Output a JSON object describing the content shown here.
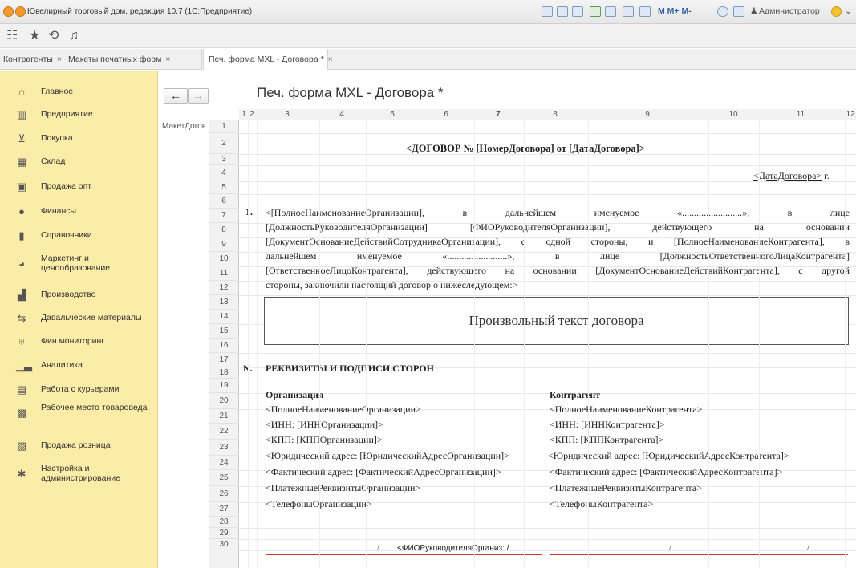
{
  "window": {
    "title": "Ювелирный торговый дом, редакция 10.7 (1С:Предприятие)",
    "toolbar_text": "M  M+  M-",
    "user": "Администратор"
  },
  "tabs": [
    {
      "label": "Контрагенты"
    },
    {
      "label": "Макеты печатных форм"
    },
    {
      "label": "Печ. форма MXL - Договора *"
    }
  ],
  "sidebar": {
    "items": [
      {
        "label": "Главное",
        "icon": "home-icon"
      },
      {
        "label": "Предприятие",
        "icon": "building-icon"
      },
      {
        "label": "Покупка",
        "icon": "cart-icon"
      },
      {
        "label": "Склад",
        "icon": "warehouse-icon"
      },
      {
        "label": "Продажа опт",
        "icon": "bag-icon"
      },
      {
        "label": "Финансы",
        "icon": "coin-icon"
      },
      {
        "label": "Справочники",
        "icon": "book-icon"
      },
      {
        "label": "Маркетинг и ценообразование",
        "icon": "pie-icon"
      },
      {
        "label": "Производство",
        "icon": "factory-icon"
      },
      {
        "label": "Давальческие материалы",
        "icon": "exchange-icon"
      },
      {
        "label": "Фин мониторинг",
        "icon": "eagle-icon"
      },
      {
        "label": "Аналитика",
        "icon": "chart-icon"
      },
      {
        "label": "Работа с курьерами",
        "icon": "courier-icon"
      },
      {
        "label": "Рабочее место товароведа",
        "icon": "workplace-icon"
      },
      {
        "label": "Продажа розница",
        "icon": "register-icon"
      },
      {
        "label": "Настройка и администрирование",
        "icon": "gear-icon"
      }
    ]
  },
  "doc": {
    "title": "Печ. форма MXL - Договора *",
    "area_name": "МакетДогов",
    "columns": [
      "1",
      "2",
      "3",
      "4",
      "5",
      "6",
      "7",
      "8",
      "9",
      "10",
      "11",
      "12"
    ],
    "rows": [
      "1",
      "2",
      "3",
      "4",
      "5",
      "6",
      "7",
      "8",
      "9",
      "10",
      "11",
      "12",
      "13",
      "14",
      "15",
      "16",
      "17",
      "18",
      "19",
      "20",
      "21",
      "22",
      "23",
      "24",
      "25",
      "26",
      "27",
      "28",
      "29",
      "30"
    ],
    "heading": "<ДОГОВОР № [НомерДоговора] от [ДатаДоговора]>",
    "date_ref": "<ДатаДоговора>",
    "date_suffix": "г.",
    "section1_num": "1.",
    "preamble": [
      "<[ПолноеНаименованиеОрганизации], в дальнейшем именуемое «.........................», в лице",
      "[ДолжностьРуководителяОрганизации] [ФИОРуководителяОрганизации], действующего на основании",
      "[ДокументОснованиеДействийСотрудникаОрганизации], с одной стороны, и [ПолноеНаименованиеКонтрагента], в",
      "дальнейшем именуемое «.........................», в лице [ДолжностьОтветственногоЛицаКонтрагента]",
      "[ОтветственноеЛицоКонтрагента], действующего на основании [ДокументОснованиеДействийКонтрагента], с другой",
      "стороны, заключили настоящий договор о нижеследующем:>"
    ],
    "free_text": "Произвольный текст договора",
    "sectionN_num": "N.",
    "sectionN_title": "РЕКВИЗИТЫ И ПОДПИСИ СТОРОН",
    "org_header": "Организация",
    "contr_header": "Контрагент",
    "org_lines": [
      "<ПолноеНаименованиеОрганизации>",
      "<ИНН: [ИННОрганизации]>",
      "<КПП: [КППОрганизации]>",
      "<Юридический адрес: [ЮридическийАдресОрганизации]>",
      "<Фактический адрес: [ФактическийАдресОрганизации]>",
      "<ПлатежныеРеквизитыОрганизации>",
      "<ТелефоныОрганизации>"
    ],
    "contr_lines": [
      "<ПолноеНаименованиеКонтрагента>",
      "<ИНН: [ИННКонтрагента]>",
      "<КПП: [КППКонтрагента]>",
      "<Юридический адрес: [ЮридическийАдресКонтрагента]>",
      "<Фактический адрес: [ФактическийАдресКонтрагента]>",
      "<ПлатежныеРеквизитыКонтрагента>",
      "<ТелефоныКонтрагента>"
    ],
    "sign_slash": "/",
    "sign_name": "<ФИОРуководителяОрганиз: /"
  }
}
